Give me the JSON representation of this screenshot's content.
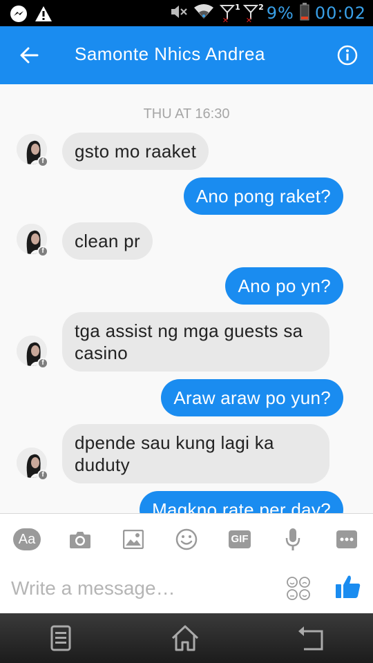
{
  "status_bar": {
    "battery_percent": "9%",
    "time": "00:02",
    "sim1": "1",
    "sim2": "2",
    "icons": [
      "messenger-icon",
      "warning-icon",
      "mute-icon",
      "wifi-icon",
      "signal-icon",
      "battery-icon"
    ],
    "accent": "#39a0e8"
  },
  "header": {
    "title": "Samonte Nhics Andrea",
    "color": "#1a8cf0"
  },
  "conversation": {
    "timestamp": "THU AT 16:30",
    "messages": [
      {
        "sender": "them",
        "text": "gsto mo raaket"
      },
      {
        "sender": "me",
        "text": "Ano pong raket?"
      },
      {
        "sender": "them",
        "text": "clean pr"
      },
      {
        "sender": "me",
        "text": "Ano po yn?"
      },
      {
        "sender": "them",
        "text": "tga assist ng mga guests sa casino"
      },
      {
        "sender": "me",
        "text": "Araw araw po yun?"
      },
      {
        "sender": "them",
        "text": "dpende sau kung lagi ka duduty"
      },
      {
        "sender": "me",
        "text": "Magkno rate per day?"
      }
    ]
  },
  "toolbar": {
    "text_label": "Aa",
    "gif_label": "GIF",
    "icons": [
      "text-format-icon",
      "camera-icon",
      "gallery-icon",
      "emoji-icon",
      "gif-icon",
      "microphone-icon",
      "more-icon"
    ]
  },
  "composer": {
    "placeholder": "Write a message…"
  },
  "nav_bar": {
    "icons": [
      "menu-icon",
      "home-icon",
      "back-icon"
    ]
  }
}
